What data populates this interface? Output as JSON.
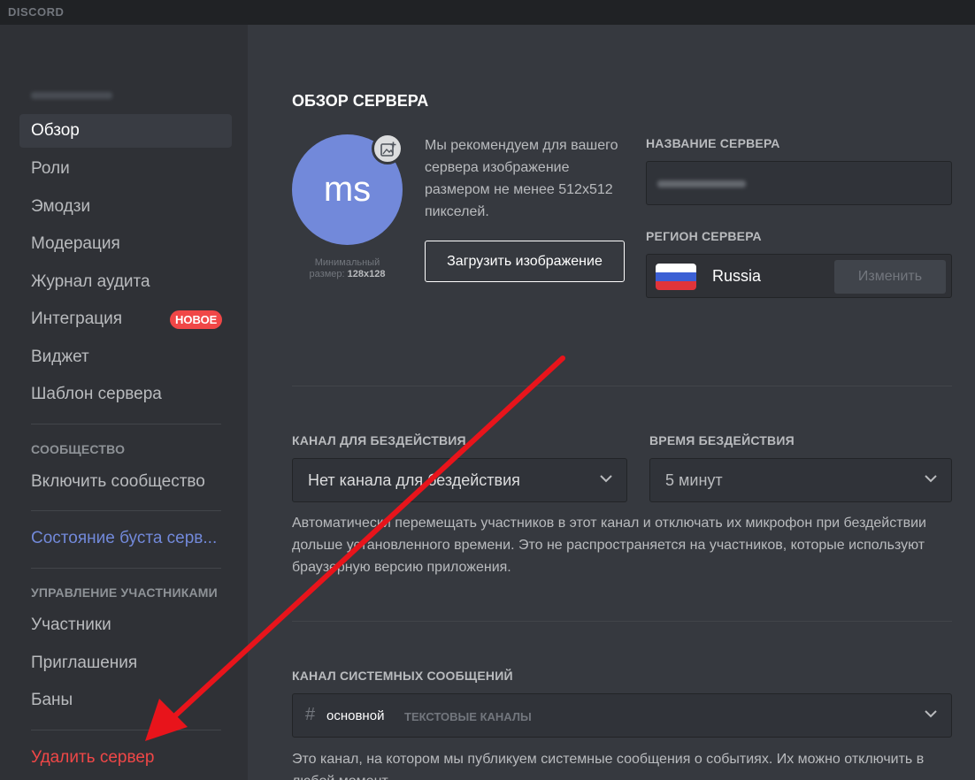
{
  "app": {
    "brand": "DISCORD"
  },
  "sidebar": {
    "items": [
      {
        "label": "Обзор"
      },
      {
        "label": "Роли"
      },
      {
        "label": "Эмодзи"
      },
      {
        "label": "Модерация"
      },
      {
        "label": "Журнал аудита"
      },
      {
        "label": "Интеграция",
        "badge": "НОВОЕ"
      },
      {
        "label": "Виджет"
      },
      {
        "label": "Шаблон сервера"
      }
    ],
    "community_header": "СООБЩЕСТВО",
    "community_item": "Включить сообщество",
    "boost_item": "Состояние буста серв...",
    "members_header": "УПРАВЛЕНИЕ УЧАСТНИКАМИ",
    "members_items": [
      "Участники",
      "Приглашения",
      "Баны"
    ],
    "delete_item": "Удалить сервер"
  },
  "overview": {
    "title": "ОБЗОР СЕРВЕРА",
    "avatar_initials": "ms",
    "min_size_label": "Минимальный",
    "min_size_prefix": "размер:",
    "min_size_value": "128x128",
    "recommend_text": "Мы рекомендуем для вашего сервера изображение размером не менее 512x512 пикселей.",
    "upload_button": "Загрузить изображение",
    "server_name_label": "НАЗВАНИЕ СЕРВЕРА",
    "region_label": "РЕГИОН СЕРВЕРА",
    "region_value": "Russia",
    "change_button": "Изменить"
  },
  "afk": {
    "channel_label": "КАНАЛ ДЛЯ БЕЗДЕЙСТВИЯ",
    "channel_value": "Нет канала для бездействия",
    "timeout_label": "ВРЕМЯ БЕЗДЕЙСТВИЯ",
    "timeout_value": "5 минут",
    "help_text": "Автоматически перемещать участников в этот канал и отключать их микрофон при бездействии дольше установленного времени. Это не распространяется на участников, которые используют браузерную версию приложения."
  },
  "system": {
    "label": "КАНАЛ СИСТЕМНЫХ СООБЩЕНИЙ",
    "hash": "#",
    "channel": "основной",
    "category": "ТЕКСТОВЫЕ КАНАЛЫ",
    "help_text": "Это канал, на котором мы публикуем системные сообщения о событиях. Их можно отключить в любой момент."
  },
  "colors": {
    "accent": "#7289da",
    "danger": "#f04747",
    "annotation_arrow": "#e8141b"
  },
  "icons": [
    "add-image-icon",
    "chevron-down-icon",
    "russia-flag-icon"
  ]
}
